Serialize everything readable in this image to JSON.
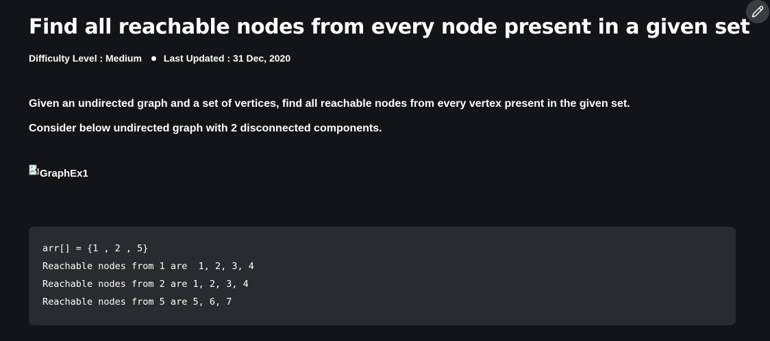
{
  "article": {
    "title": "Find all reachable nodes from every node present in a given set",
    "difficulty": "Difficulty Level : Medium",
    "last_updated": "Last Updated : 31 Dec, 2020",
    "paragraphs": [
      "Given an undirected graph and a set of vertices, find all reachable nodes from every vertex present in the given set.",
      "Consider below undirected graph with 2 disconnected components."
    ],
    "image_alt": "GraphEx1",
    "code_lines": [
      "arr[] = {1 , 2 , 5}",
      "Reachable nodes from 1 are  1, 2, 3, 4",
      "Reachable nodes from 2 are 1, 2, 3, 4",
      "Reachable nodes from 5 are 5, 6, 7"
    ]
  },
  "toolbar": {
    "edit_icon": "pencil-icon"
  },
  "colors": {
    "background": "#131417",
    "code_background": "#2a2b2e",
    "text": "#ffffff",
    "edit_button": "#3c3d40"
  }
}
